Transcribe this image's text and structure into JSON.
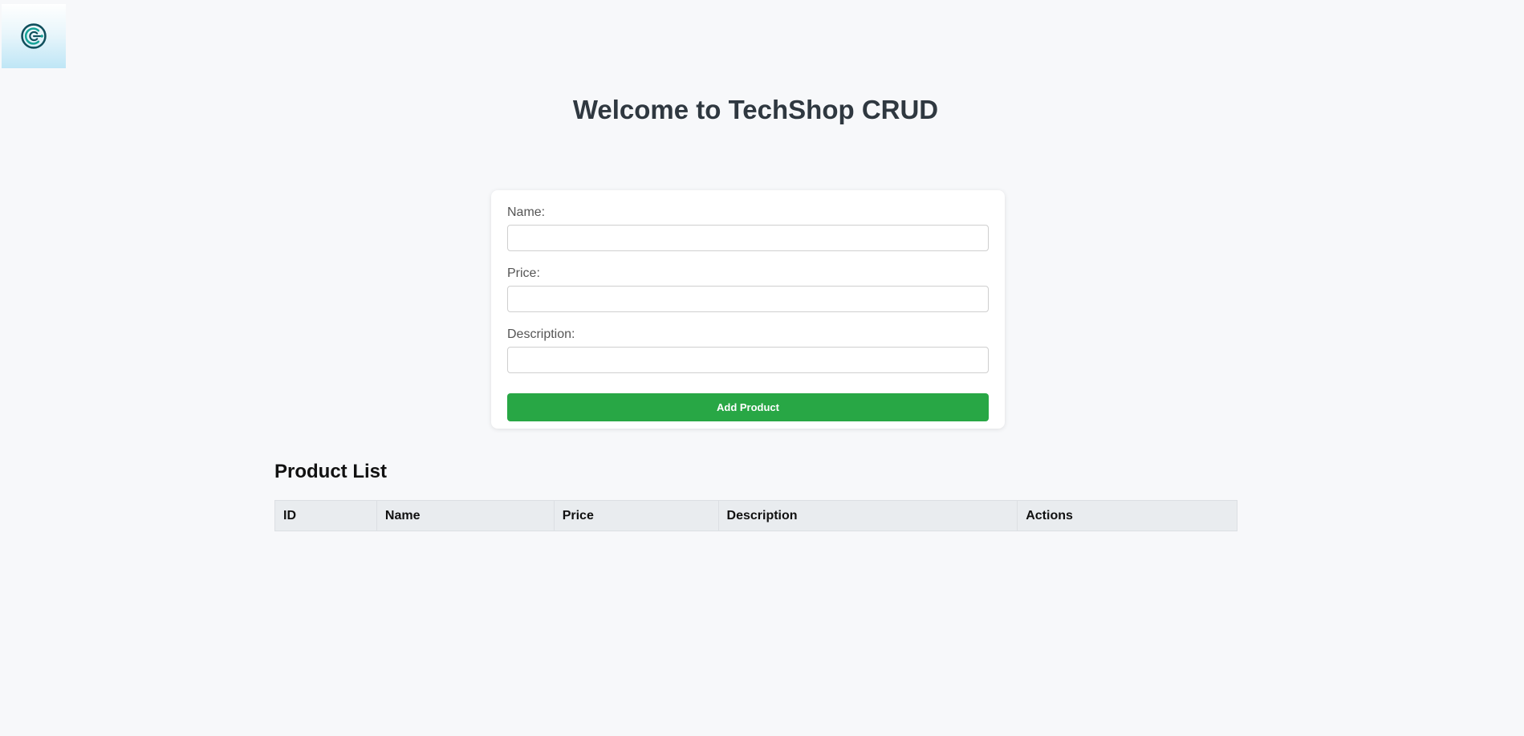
{
  "header": {
    "logo_icon": "circuit-c-logo-icon",
    "title": "Welcome to TechShop CRUD"
  },
  "form": {
    "name_label": "Name:",
    "name_value": "",
    "price_label": "Price:",
    "price_value": "",
    "description_label": "Description:",
    "description_value": "",
    "submit_label": "Add Product"
  },
  "product_list": {
    "heading": "Product List",
    "columns": [
      "ID",
      "Name",
      "Price",
      "Description",
      "Actions"
    ],
    "rows": []
  },
  "colors": {
    "background": "#f7f8fa",
    "accent_button": "#28a745",
    "table_header_bg": "#e9ecef",
    "title_text": "#2f3840"
  }
}
